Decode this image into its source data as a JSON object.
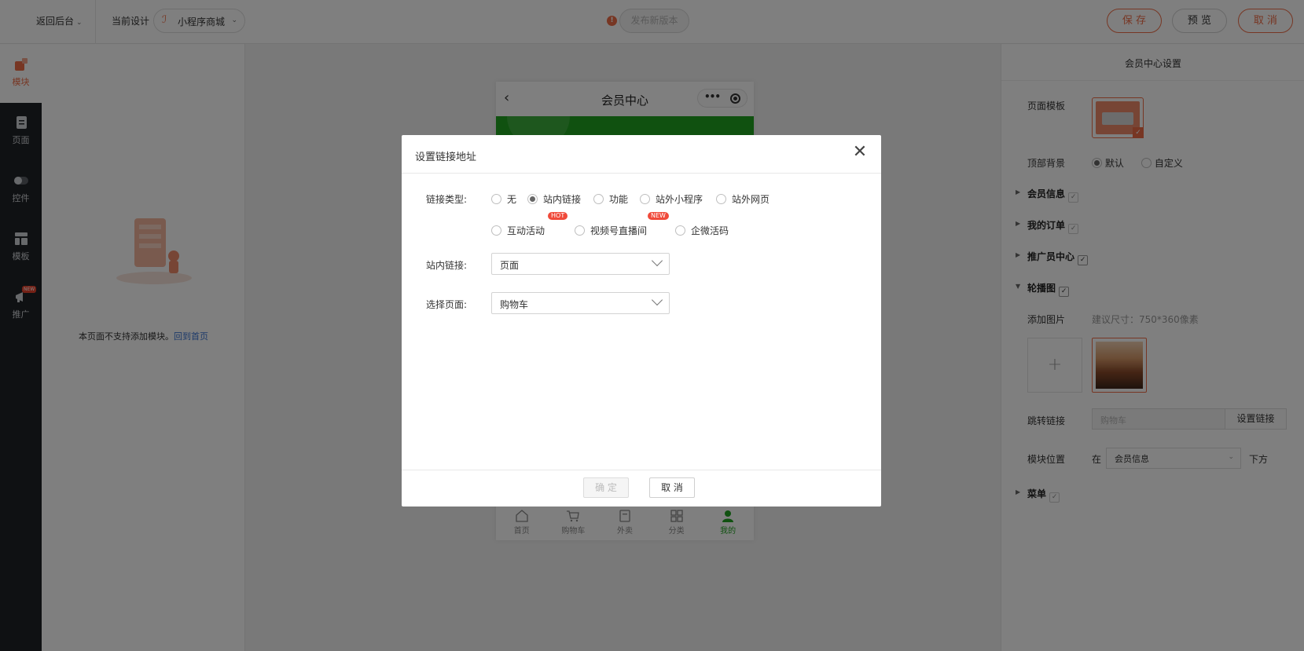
{
  "topbar": {
    "back_label": "返回后台",
    "current_design_label": "当前设计",
    "design_select_value": "小程序商城",
    "publish_label": "发布新版本",
    "save_label": "保 存",
    "preview_label": "预 览",
    "cancel_label": "取 消"
  },
  "sidebar": {
    "items": [
      {
        "label": "模块",
        "icon": "modules-icon"
      },
      {
        "label": "页面",
        "icon": "page-icon"
      },
      {
        "label": "控件",
        "icon": "toggle-icon"
      },
      {
        "label": "模板",
        "icon": "template-icon"
      },
      {
        "label": "推广",
        "icon": "megaphone-icon",
        "badge": "NEW"
      }
    ]
  },
  "modules_panel": {
    "empty_text": "本页面不支持添加模块。",
    "back_home_link": "回到首页"
  },
  "phone": {
    "title": "会员中心",
    "tabs": [
      {
        "label": "首页"
      },
      {
        "label": "购物车"
      },
      {
        "label": "外卖"
      },
      {
        "label": "分类"
      },
      {
        "label": "我的"
      }
    ]
  },
  "settings": {
    "title": "会员中心设置",
    "page_template_label": "页面模板",
    "top_bg_label": "顶部背景",
    "top_bg_options": [
      "默认",
      "自定义"
    ],
    "sections": {
      "member_info": "会员信息",
      "my_orders": "我的订单",
      "promoter_center": "推广员中心",
      "carousel": "轮播图",
      "menu": "菜单"
    },
    "add_image_label": "添加图片",
    "size_hint": "建议尺寸：750*360像素",
    "add_symbol": "+",
    "jump_link_label": "跳转链接",
    "jump_link_placeholder": "购物车",
    "set_link_button": "设置链接",
    "module_position_label": "模块位置",
    "position_prefix": "在",
    "position_value": "会员信息",
    "position_suffix": "下方"
  },
  "modal": {
    "title": "设置链接地址",
    "link_type_label": "链接类型:",
    "link_types": [
      {
        "label": "无",
        "selected": false
      },
      {
        "label": "站内链接",
        "selected": true
      },
      {
        "label": "功能",
        "selected": false
      },
      {
        "label": "站外小程序",
        "selected": false
      },
      {
        "label": "站外网页",
        "selected": false
      },
      {
        "label": "互动活动",
        "selected": false,
        "badge": "HOT"
      },
      {
        "label": "视频号直播间",
        "selected": false,
        "badge": "NEW"
      },
      {
        "label": "企微活码",
        "selected": false
      }
    ],
    "internal_link_label": "站内链接:",
    "internal_link_value": "页面",
    "select_page_label": "选择页面:",
    "select_page_value": "购物车",
    "ok_label": "确 定",
    "cancel_label": "取 消"
  },
  "colors": {
    "accent": "#ef6c46",
    "phone_green": "#21a321",
    "sidebar_bg": "#1f2227",
    "badge_red": "#f04a3a"
  }
}
